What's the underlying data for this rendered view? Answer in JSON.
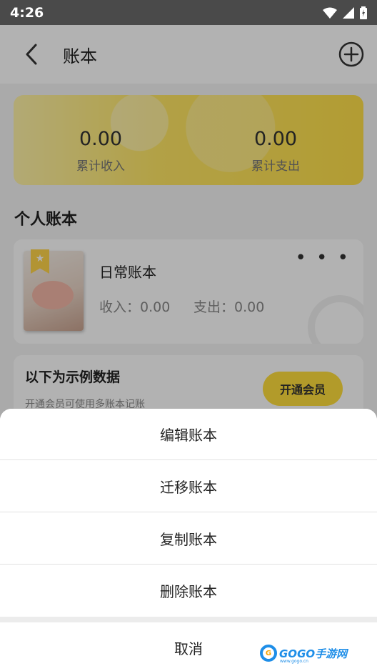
{
  "status_bar": {
    "time": "4:26"
  },
  "app_bar": {
    "title": "账本"
  },
  "summary": {
    "income_value": "0.00",
    "income_label": "累计收入",
    "expense_value": "0.00",
    "expense_label": "累计支出"
  },
  "section": {
    "title": "个人账本"
  },
  "ledger": {
    "name": "日常账本",
    "income": "收入：0.00",
    "expense": "支出：0.00",
    "more_glyph": "• • •"
  },
  "sample": {
    "title": "以下为示例数据",
    "subtitle": "开通会员可使用多账本记账",
    "vip_button": "开通会员"
  },
  "sheet": {
    "items": [
      "编辑账本",
      "迁移账本",
      "复制账本",
      "删除账本"
    ],
    "cancel": "取消"
  },
  "watermark": {
    "text": "GOGO手游网",
    "sub": "www.gogo.cn"
  },
  "colors": {
    "accent_yellow": "#ffde3d",
    "scrim": "rgba(0,0,0,0.30)",
    "status_bar": "#4a4a4a"
  }
}
